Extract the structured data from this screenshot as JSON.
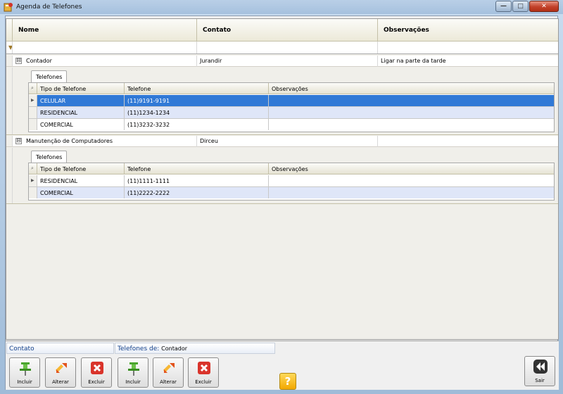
{
  "window": {
    "title": "Agenda de Telefones",
    "controls": {
      "minimize": "—",
      "maximize": "□",
      "close": "✕"
    }
  },
  "grid": {
    "columns": [
      "Nome",
      "Contato",
      "Observações"
    ],
    "master_rows": [
      {
        "nome": "Contador",
        "contato": "Jurandir",
        "observacoes": "Ligar na parte da tarde",
        "expander": "⊟",
        "detail": {
          "tab": "Telefones",
          "columns": [
            "Tipo de Telefone",
            "Telefone",
            "Observações"
          ],
          "rows": [
            {
              "tipo": "CELULAR",
              "telefone": "(11)9191-9191",
              "obs": "",
              "state": "selected"
            },
            {
              "tipo": "RESIDENCIAL",
              "telefone": "(11)1234-1234",
              "obs": "",
              "state": "alt"
            },
            {
              "tipo": "COMERCIAL",
              "telefone": "(11)3232-3232",
              "obs": "",
              "state": "normal"
            }
          ]
        }
      },
      {
        "nome": "Manutenção de Computadores",
        "contato": "Dirceu",
        "observacoes": "",
        "expander": "⊟",
        "detail": {
          "tab": "Telefones",
          "columns": [
            "Tipo de Telefone",
            "Telefone",
            "Observações"
          ],
          "rows": [
            {
              "tipo": "RESIDENCIAL",
              "telefone": "(11)1111-1111",
              "obs": "",
              "state": "normal"
            },
            {
              "tipo": "COMERCIAL",
              "telefone": "(11)2222-2222",
              "obs": "",
              "state": "alt"
            }
          ]
        }
      }
    ]
  },
  "bottom": {
    "contato_group": {
      "title": "Contato",
      "buttons": {
        "incluir": "Incluir",
        "alterar": "Alterar",
        "excluir": "Excluir"
      }
    },
    "telefones_group": {
      "title": "Telefones de:",
      "subject": "Contador",
      "buttons": {
        "incluir": "Incluir",
        "alterar": "Alterar",
        "excluir": "Excluir"
      }
    },
    "help_label": "?",
    "exit_label": "Sair"
  },
  "colors": {
    "selection": "#3079d6",
    "alt_row": "#dfe6f8",
    "group_title": "#15428b"
  }
}
